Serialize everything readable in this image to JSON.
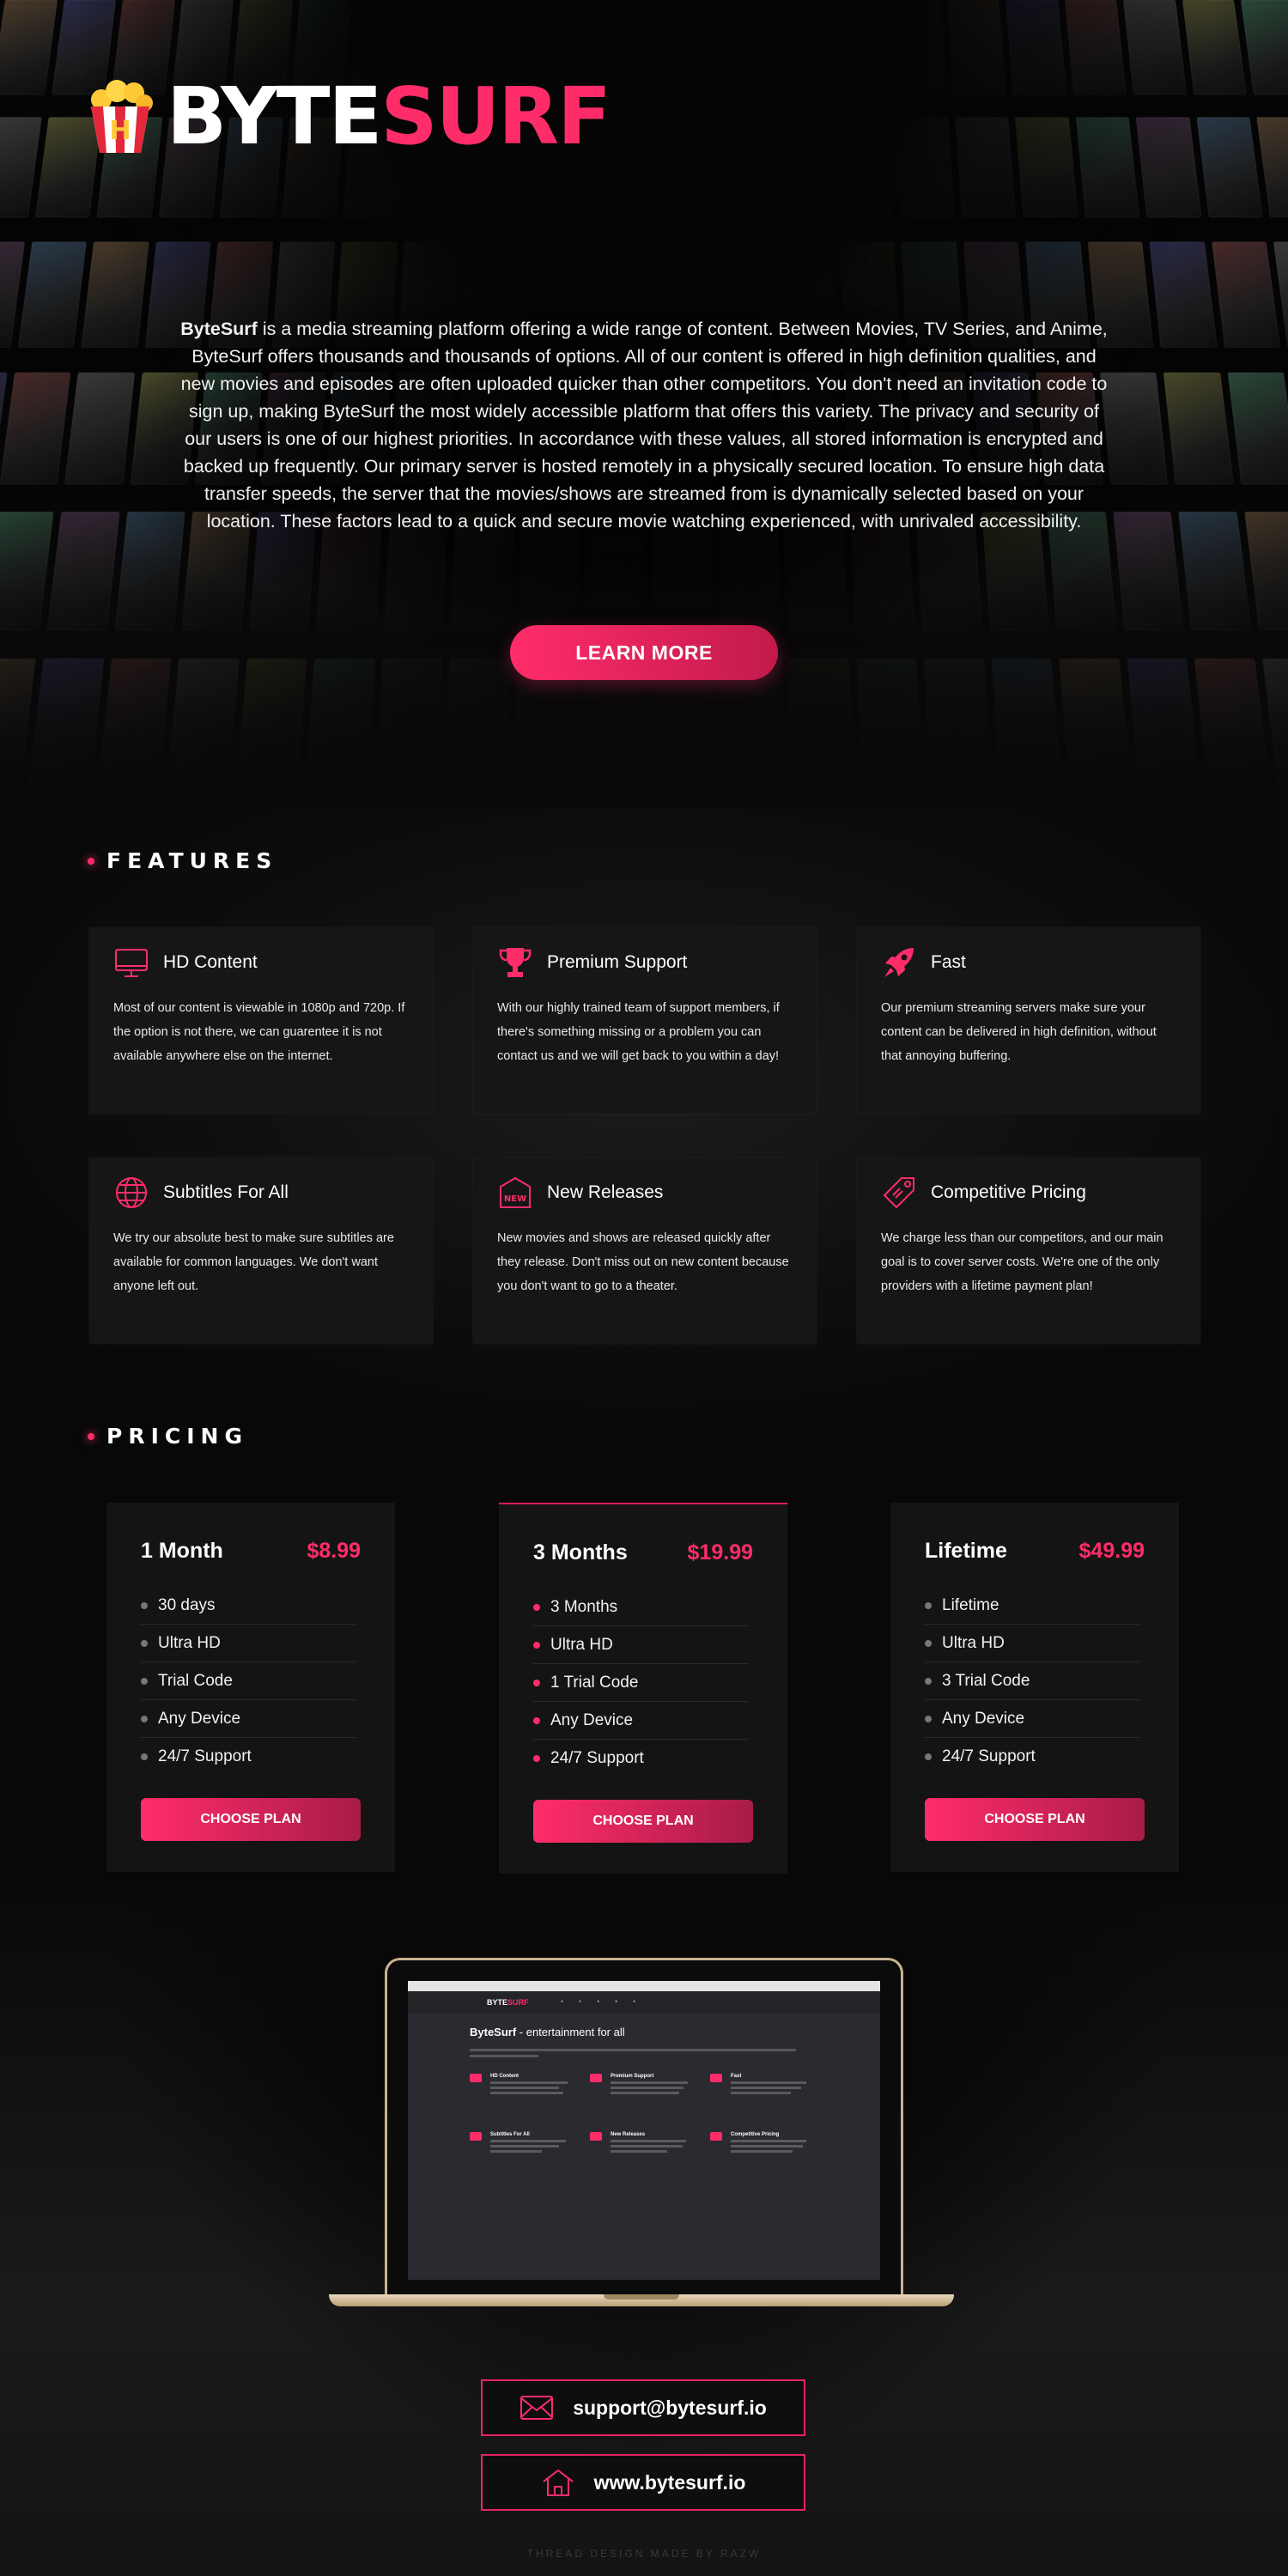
{
  "brand": {
    "name_part1": "BYTE",
    "name_part2": "SURF",
    "accent": "#ff2c6a"
  },
  "intro": {
    "lead": "ByteSurf",
    "text": " is a media streaming platform offering a wide range of content. Between Movies, TV Series, and Anime, ByteSurf offers thousands and thousands of options. All of our content is offered in high definition qualities, and new movies and episodes are often uploaded quicker than other competitors. You don't need an invitation code to sign up, making ByteSurf the most widely accessible platform that offers this variety. The privacy and security of our users is one of our highest priorities. In accordance with these values, all stored information is encrypted and backed up frequently. Our primary server is hosted remotely in a physically secured location. To ensure high data transfer speeds, the server that the movies/shows are streamed from is dynamically selected based on your location. These factors lead to a quick and secure movie watching experienced, with unrivaled accessibility.",
    "button": "LEARN MORE"
  },
  "features": {
    "heading": "FEATURES",
    "items": [
      {
        "icon": "monitor-icon",
        "title": "HD Content",
        "desc": "Most of our content is viewable in 1080p and 720p. If the option is not there, we can guarentee it is not available anywhere else on the internet."
      },
      {
        "icon": "trophy-icon",
        "title": "Premium Support",
        "desc": "With our highly trained team of support members, if there's something missing or a problem you can contact us and we will get back to you within a day!"
      },
      {
        "icon": "rocket-icon",
        "title": "Fast",
        "desc": "Our premium streaming servers make sure your content can be delivered in high definition, without that annoying buffering."
      },
      {
        "icon": "globe-icon",
        "title": "Subtitles For All",
        "desc": "We try our absolute best to make sure subtitles are available for common languages. We don't want anyone left out."
      },
      {
        "icon": "new-badge-icon",
        "title": "New Releases",
        "desc": "New movies and shows are released quickly after they release. Don't miss out on new content because you don't want to go to a theater."
      },
      {
        "icon": "price-tag-icon",
        "title": "Competitive Pricing",
        "desc": "We charge less than our competitors, and our main goal is to cover server costs. We're one of the only providers with a lifetime payment plan!"
      }
    ]
  },
  "pricing": {
    "heading": "PRICING",
    "plans": [
      {
        "name": "1 Month",
        "price": "$8.99",
        "features": [
          "30 days",
          "Ultra HD",
          "Trial Code",
          "Any Device",
          "24/7 Support"
        ],
        "button": "CHOOSE PLAN"
      },
      {
        "name": "3 Months",
        "price": "$19.99",
        "features": [
          "3 Months",
          "Ultra HD",
          "1 Trial Code",
          "Any Device",
          "24/7 Support"
        ],
        "button": "CHOOSE PLAN"
      },
      {
        "name": "Lifetime",
        "price": "$49.99",
        "features": [
          "Lifetime",
          "Ultra HD",
          "3 Trial Code",
          "Any Device",
          "24/7 Support"
        ],
        "button": "CHOOSE PLAN"
      }
    ]
  },
  "laptop": {
    "headline_bold": "ByteSurf",
    "headline_rest": " - entertainment for all"
  },
  "contact": {
    "email": "support@bytesurf.io",
    "website": "www.bytesurf.io"
  },
  "footer": {
    "credit": "THREAD DESIGN MADE BY RAZW"
  }
}
